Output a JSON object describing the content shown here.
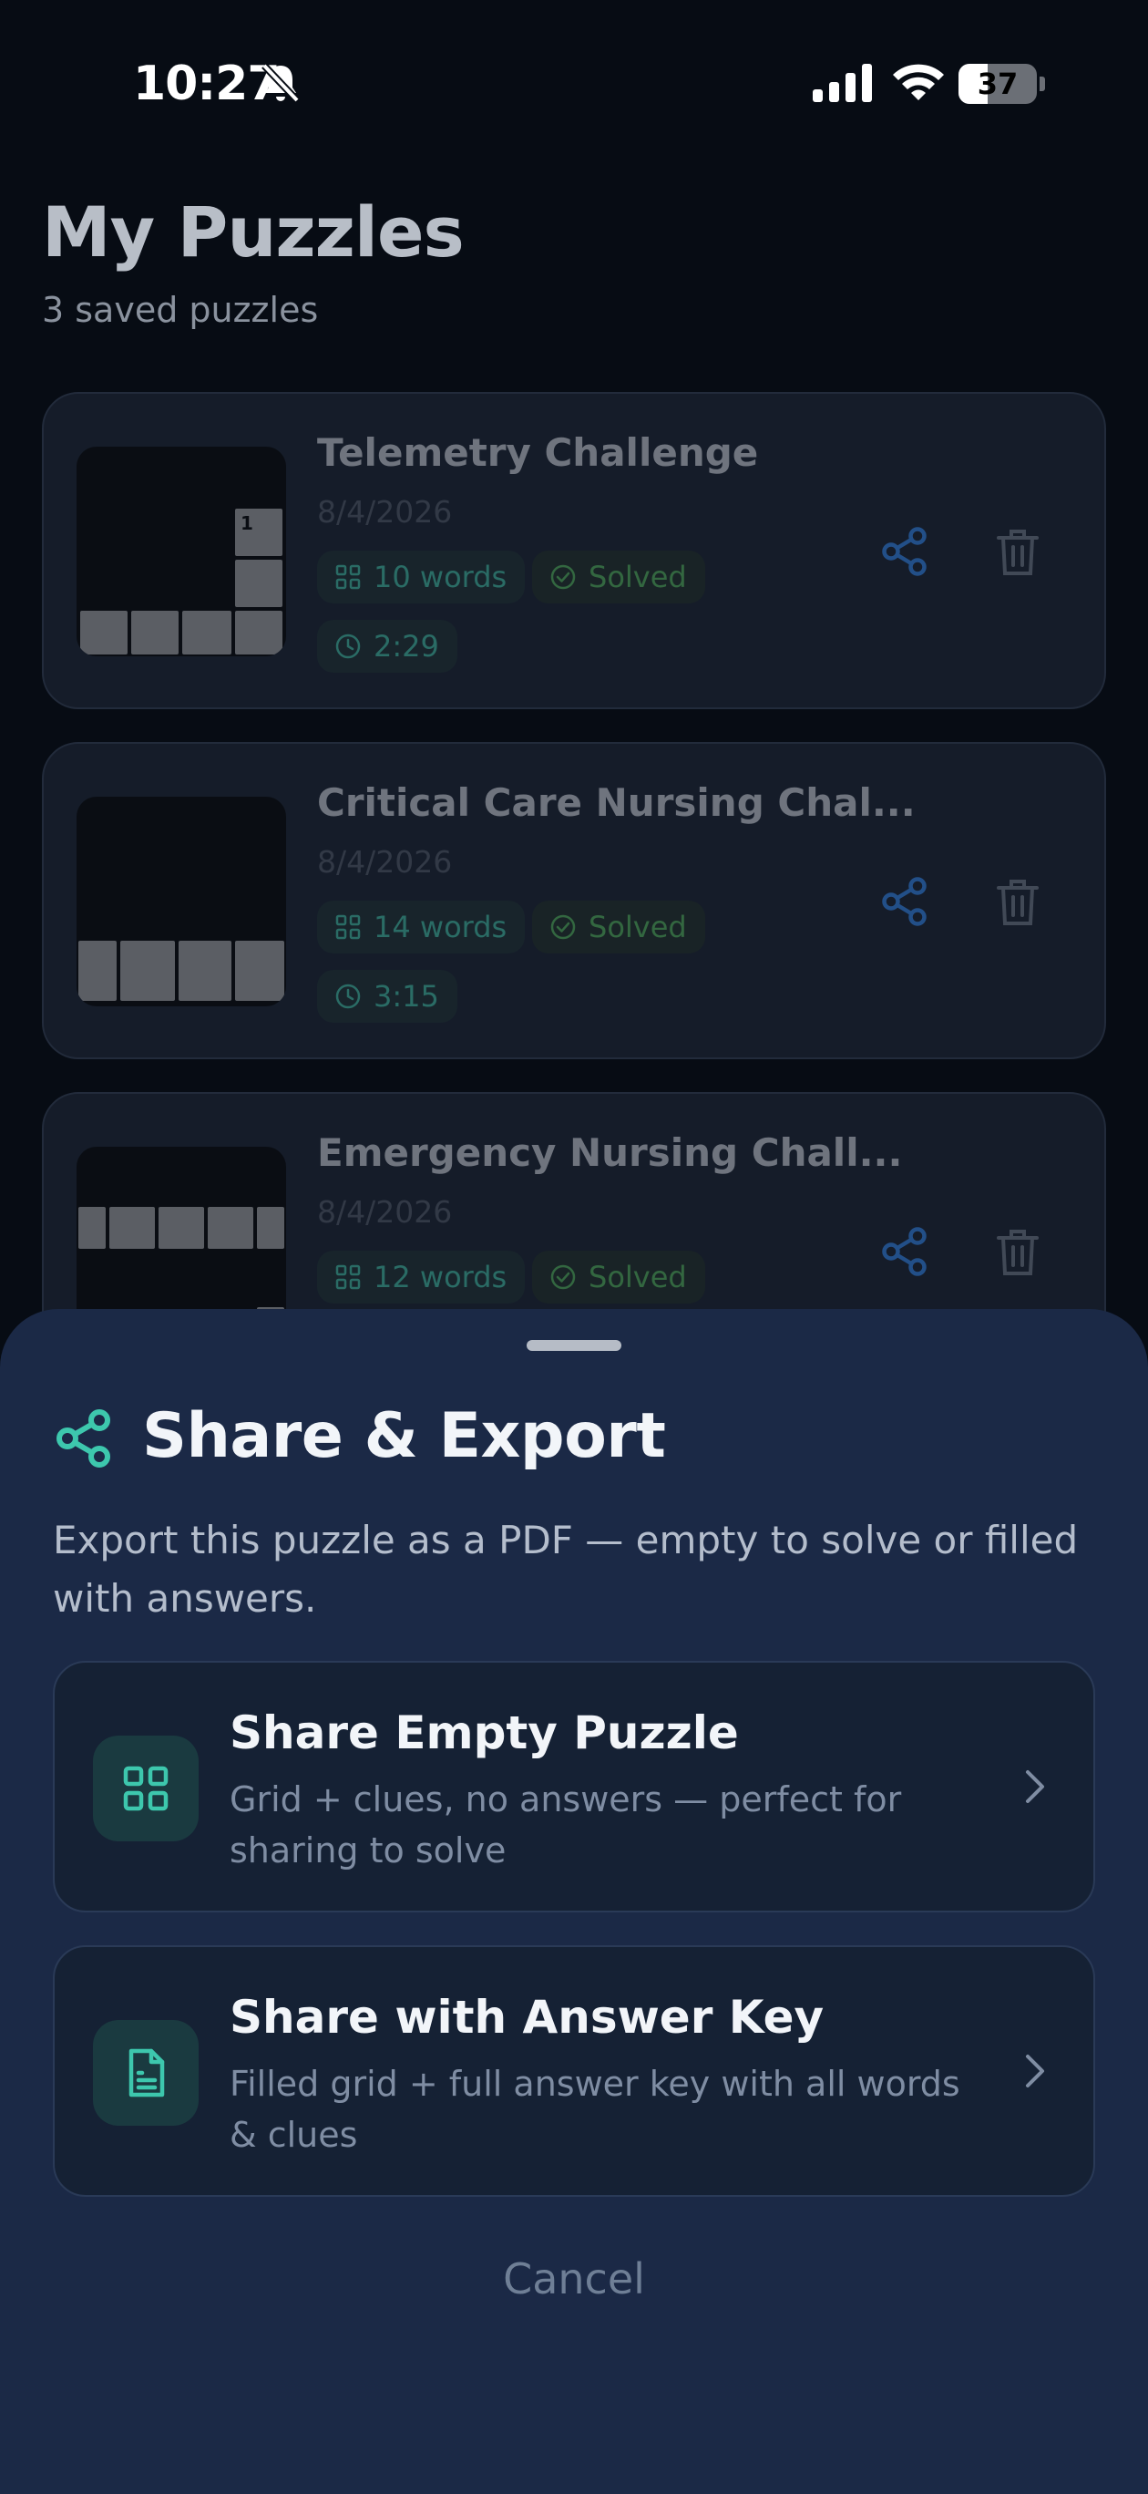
{
  "status_bar": {
    "time": "10:27",
    "battery_level": "37",
    "battery_fraction": 0.37
  },
  "header": {
    "title": "My Puzzles",
    "subtitle": "3 saved puzzles"
  },
  "puzzles": [
    {
      "title": "Telemetry Challenge",
      "date": "8/4/2026",
      "words": "10 words",
      "status": "Solved",
      "time": "2:29",
      "grid_number": "1"
    },
    {
      "title": "Critical Care Nursing Chal...",
      "date": "8/4/2026",
      "words": "14 words",
      "status": "Solved",
      "time": "3:15"
    },
    {
      "title": "Emergency Nursing Chall...",
      "date": "8/4/2026",
      "words": "12 words",
      "status": "Solved"
    }
  ],
  "sheet": {
    "title": "Share & Export",
    "description": "Export this puzzle as a PDF — empty to solve or filled with answers.",
    "options": [
      {
        "title": "Share Empty Puzzle",
        "description": "Grid + clues, no answers — perfect for sharing to solve",
        "icon": "grid-icon"
      },
      {
        "title": "Share with Answer Key",
        "description": "Filled grid + full answer key with all words & clues",
        "icon": "document-icon"
      }
    ],
    "cancel_label": "Cancel"
  },
  "colors": {
    "accent_teal": "#3dc7ad",
    "accent_blue": "#2f7fe0",
    "sheet_bg": "#1b2946",
    "solved_green": "#4fae58"
  }
}
